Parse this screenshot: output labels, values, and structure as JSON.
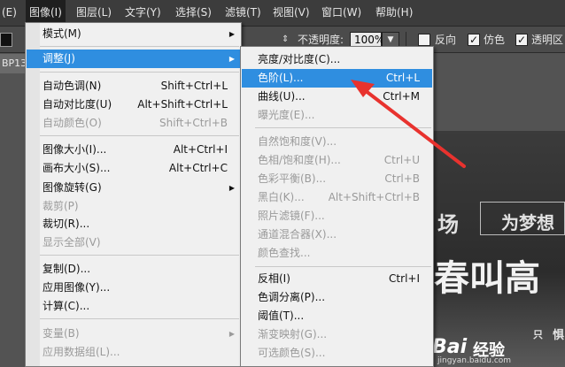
{
  "menubar": {
    "items": [
      {
        "label": "(E)"
      },
      {
        "label": "图像(I)"
      },
      {
        "label": "图层(L)"
      },
      {
        "label": "文字(Y)"
      },
      {
        "label": "选择(S)"
      },
      {
        "label": "滤镜(T)"
      },
      {
        "label": "视图(V)"
      },
      {
        "label": "窗口(W)"
      },
      {
        "label": "帮助(H)"
      }
    ]
  },
  "options": {
    "opacity_label": "不透明度:",
    "opacity_value": "100%",
    "reverse_label": "反向",
    "dither_label": "仿色",
    "transparency_label": "透明区"
  },
  "document_tab": {
    "label": "BP13"
  },
  "image_menu": {
    "items": [
      {
        "label": "模式(M)",
        "shortcut": "",
        "arrow": "▶"
      },
      {
        "label": "调整(J)",
        "shortcut": "",
        "arrow": "▶"
      },
      {
        "label": "自动色调(N)",
        "shortcut": "Shift+Ctrl+L"
      },
      {
        "label": "自动对比度(U)",
        "shortcut": "Alt+Shift+Ctrl+L"
      },
      {
        "label": "自动颜色(O)",
        "shortcut": "Shift+Ctrl+B"
      },
      {
        "label": "图像大小(I)...",
        "shortcut": "Alt+Ctrl+I"
      },
      {
        "label": "画布大小(S)...",
        "shortcut": "Alt+Ctrl+C"
      },
      {
        "label": "图像旋转(G)",
        "shortcut": "",
        "arrow": "▶"
      },
      {
        "label": "裁剪(P)",
        "shortcut": ""
      },
      {
        "label": "裁切(R)...",
        "shortcut": ""
      },
      {
        "label": "显示全部(V)",
        "shortcut": ""
      },
      {
        "label": "复制(D)...",
        "shortcut": ""
      },
      {
        "label": "应用图像(Y)...",
        "shortcut": ""
      },
      {
        "label": "计算(C)...",
        "shortcut": ""
      },
      {
        "label": "变量(B)",
        "shortcut": "",
        "arrow": "▶"
      },
      {
        "label": "应用数据组(L)...",
        "shortcut": ""
      }
    ]
  },
  "adjust_menu": {
    "items": [
      {
        "label": "亮度/对比度(C)...",
        "shortcut": ""
      },
      {
        "label": "色阶(L)...",
        "shortcut": "Ctrl+L"
      },
      {
        "label": "曲线(U)...",
        "shortcut": "Ctrl+M"
      },
      {
        "label": "曝光度(E)...",
        "shortcut": ""
      },
      {
        "label": "自然饱和度(V)...",
        "shortcut": ""
      },
      {
        "label": "色相/饱和度(H)...",
        "shortcut": "Ctrl+U"
      },
      {
        "label": "色彩平衡(B)...",
        "shortcut": "Ctrl+B"
      },
      {
        "label": "黑白(K)...",
        "shortcut": "Alt+Shift+Ctrl+B"
      },
      {
        "label": "照片滤镜(F)...",
        "shortcut": ""
      },
      {
        "label": "通道混合器(X)...",
        "shortcut": ""
      },
      {
        "label": "颜色查找...",
        "shortcut": ""
      },
      {
        "label": "反相(I)",
        "shortcut": "Ctrl+I"
      },
      {
        "label": "色调分离(P)...",
        "shortcut": ""
      },
      {
        "label": "阈值(T)...",
        "shortcut": ""
      },
      {
        "label": "渐变映射(G)...",
        "shortcut": ""
      },
      {
        "label": "可选颜色(S)...",
        "shortcut": ""
      }
    ]
  },
  "canvas_image": {
    "t1": "场",
    "t2": "为梦想",
    "t3": "春叫高",
    "t4": "只",
    "t5": "惧",
    "watermark": "Bai",
    "watermark2": "经验",
    "watermark_url": "jingyan.baidu.com"
  },
  "colors": {
    "highlight": "#2f8ee0",
    "annotation": "#e8322e"
  }
}
